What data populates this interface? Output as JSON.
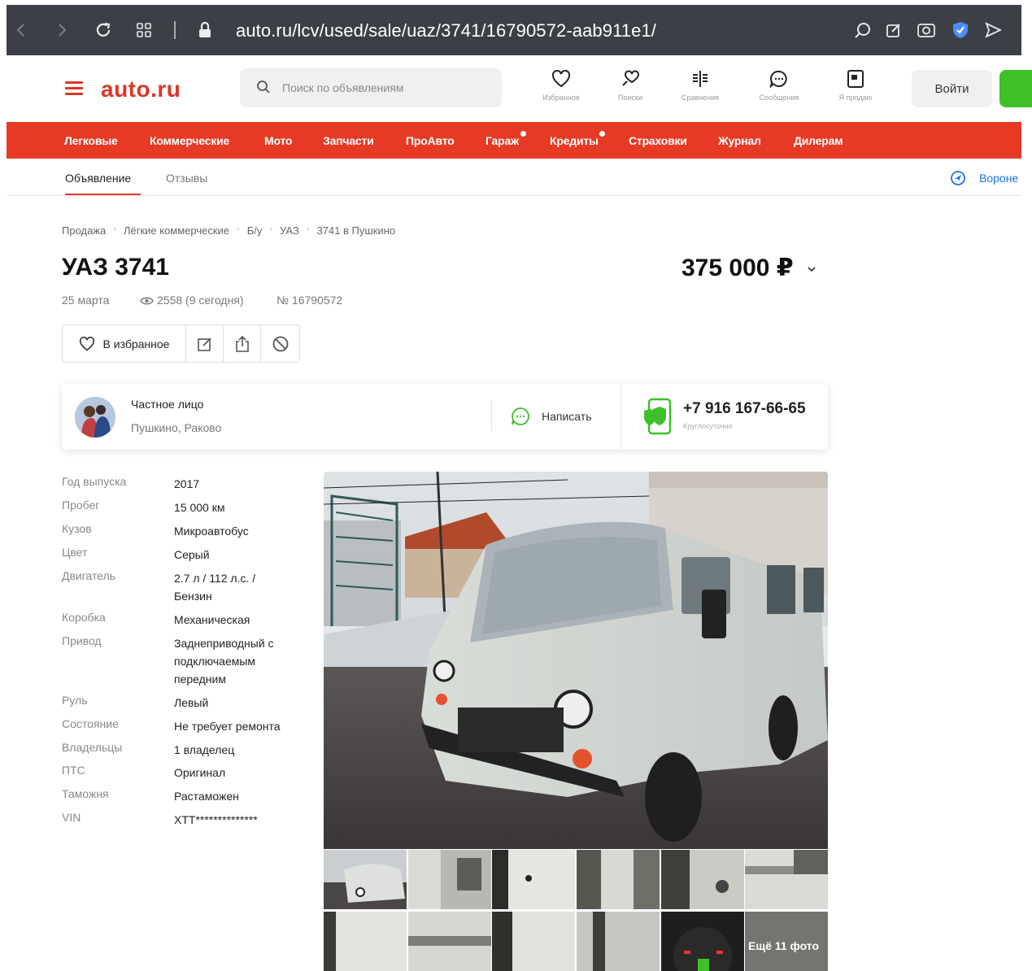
{
  "browser": {
    "url": "auto.ru/lcv/used/sale/uaz/3741/16790572-aab911e1/"
  },
  "header": {
    "logo": "auto.ru",
    "search_placeholder": "Поиск по объявлениям",
    "icons": [
      {
        "label": "Избранное",
        "icon": "heart-icon"
      },
      {
        "label": "Поиски",
        "icon": "saved-search-icon"
      },
      {
        "label": "Сравнения",
        "icon": "compare-icon"
      },
      {
        "label": "Сообщения",
        "icon": "messages-icon"
      },
      {
        "label": "Я продаю",
        "icon": "sell-icon"
      }
    ],
    "login": "Войти"
  },
  "nav": {
    "items": [
      "Легковые",
      "Коммерческие",
      "Мото",
      "Запчасти",
      "ПроАвто",
      "Гараж",
      "Кредиты",
      "Страховки",
      "Журнал",
      "Дилерам"
    ]
  },
  "tabs": {
    "ad": "Объявление",
    "reviews": "Отзывы",
    "region": "Вороне"
  },
  "breadcrumbs": [
    "Продажа",
    "Лёгкие коммерческие",
    "Б/у",
    "УАЗ",
    "3741 в Пушкино"
  ],
  "listing": {
    "title": "УАЗ 3741",
    "price": "375 000 ₽",
    "date": "25 марта",
    "views": "2558 (9 сегодня)",
    "number": "№ 16790572",
    "favorite_label": "В избранное"
  },
  "seller": {
    "type": "Частное лицо",
    "location": "Пушкино, Раково",
    "write": "Написать",
    "phone": "+7 916 167-66-65",
    "phone_note": "Круглосуточно"
  },
  "specs": [
    {
      "k": "Год выпуска",
      "v": "2017"
    },
    {
      "k": "Пробег",
      "v": "15 000 км"
    },
    {
      "k": "Кузов",
      "v": "Микроавтобус"
    },
    {
      "k": "Цвет",
      "v": "Серый"
    },
    {
      "k": "Двигатель",
      "v": "2.7 л / 112 л.с. / Бензин"
    },
    {
      "k": "Коробка",
      "v": "Механическая"
    },
    {
      "k": "Привод",
      "v": "Заднеприводный с подключаемым передним"
    },
    {
      "k": "Руль",
      "v": "Левый"
    },
    {
      "k": "Состояние",
      "v": "Не требует ремонта"
    },
    {
      "k": "Владельцы",
      "v": "1 владелец"
    },
    {
      "k": "ПТС",
      "v": "Оригинал"
    },
    {
      "k": "Таможня",
      "v": "Растаможен"
    },
    {
      "k": "VIN",
      "v": "XTT**************"
    }
  ],
  "gallery": {
    "more_photos": "Ещё 11 фото"
  }
}
